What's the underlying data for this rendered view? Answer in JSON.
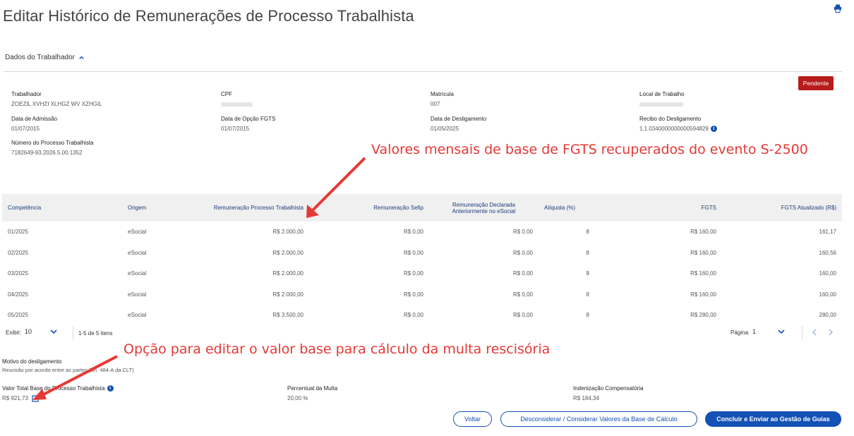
{
  "page": {
    "title": "Editar Histórico de Remunerações de Processo Trabalhista",
    "print_icon": "printer-icon"
  },
  "worker_section": {
    "toggle_label": "Dados do Trabalhador",
    "status_badge": "Pendente",
    "fields": {
      "trabalhador": {
        "label": "Trabalhador",
        "value": "ZOEZIL XVHZI XLHGZ WV XZHGIL"
      },
      "cpf": {
        "label": "CPF",
        "value": ""
      },
      "matricula": {
        "label": "Matrícula",
        "value": "007"
      },
      "local": {
        "label": "Local de Trabalho",
        "value": ""
      },
      "admissao": {
        "label": "Data de Admissão",
        "value": "01/07/2015"
      },
      "opcao_fgts": {
        "label": "Data de Opção FGTS",
        "value": "01/07/2015"
      },
      "desligamento": {
        "label": "Data de Desligamento",
        "value": "01/05/2025"
      },
      "recibo": {
        "label": "Recibo do Desligamento",
        "value": "1.1.0340000000000594829"
      },
      "processo": {
        "label": "Número do Processo Trabalhista",
        "value": "7182649-93.2026.5.00.1352"
      }
    }
  },
  "annotations": {
    "top": "Valores mensais de base de FGTS recuperados do evento S-2500",
    "bottom": "Opção para editar o valor base para cálculo da multa rescisória"
  },
  "table": {
    "headers": {
      "competencia": "Competência",
      "origem": "Origem",
      "rem_processo": "Remuneração Processo Trabalhista",
      "rem_sefip": "Remuneração Sefip",
      "rem_declarada_1": "Remuneração Declarada",
      "rem_declarada_2": "Anteriormente no eSocial",
      "aliquota": "Alíquota (%)",
      "fgts": "FGTS",
      "fgts_atualizado": "FGTS Atualizado (R$)"
    },
    "rows": [
      {
        "competencia": "01/2025",
        "origem": "eSocial",
        "rem_processo": "R$ 2.000,00",
        "rem_sefip": "R$ 0,00",
        "rem_declarada": "R$ 0,00",
        "aliquota": "8",
        "fgts": "R$ 160,00",
        "fgts_atualizado": "161,17"
      },
      {
        "competencia": "02/2025",
        "origem": "eSocial",
        "rem_processo": "R$ 2.000,00",
        "rem_sefip": "R$ 0,00",
        "rem_declarada": "R$ 0,00",
        "aliquota": "8",
        "fgts": "R$ 160,00",
        "fgts_atualizado": "160,56"
      },
      {
        "competencia": "03/2025",
        "origem": "eSocial",
        "rem_processo": "R$ 2.000,00",
        "rem_sefip": "R$ 0,00",
        "rem_declarada": "R$ 0,00",
        "aliquota": "8",
        "fgts": "R$ 160,00",
        "fgts_atualizado": "160,00"
      },
      {
        "competencia": "04/2025",
        "origem": "eSocial",
        "rem_processo": "R$ 2.000,00",
        "rem_sefip": "R$ 0,00",
        "rem_declarada": "R$ 0,00",
        "aliquota": "8",
        "fgts": "R$ 160,00",
        "fgts_atualizado": "160,00"
      },
      {
        "competencia": "05/2025",
        "origem": "eSocial",
        "rem_processo": "R$ 3.500,00",
        "rem_sefip": "R$ 0,00",
        "rem_declarada": "R$ 0,00",
        "aliquota": "8",
        "fgts": "R$ 280,00",
        "fgts_atualizado": "280,00"
      }
    ],
    "action_icons": [
      "export-xls-icon",
      "export-file-icon",
      "columns-icon"
    ]
  },
  "pagination": {
    "exibir_label": "Exibir:",
    "exibir_value": "10",
    "range_text": "1-5 de 5 itens",
    "pagina_label": "Página:",
    "pagina_value": "1"
  },
  "summary": {
    "motivo_label": "Motivo do desligamento",
    "motivo_value": "Rescisão por acordo entre as partes (art. 484-A da CLT)",
    "valor_label": "Valor Total Base do Processo Trabalhista",
    "valor_value": "R$ 921,73",
    "percentual_label": "Percentual da Multa",
    "percentual_value": "20,00 %",
    "indenizacao_label": "Indenização Compensatória",
    "indenizacao_value": "R$ 184,34"
  },
  "buttons": {
    "voltar": "Voltar",
    "desconsiderar": "Desconsiderar / Considerar Valores da Base de Cálculo",
    "concluir": "Concluir e Enviar ao Gestão de Guias"
  },
  "colors": {
    "primary": "#1351b4",
    "badge": "#b71c1c",
    "annotation": "#e53935"
  }
}
